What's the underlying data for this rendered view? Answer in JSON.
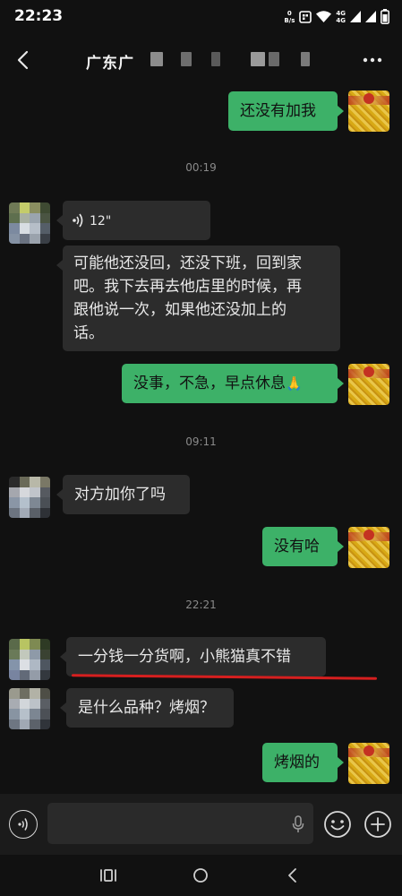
{
  "status_bar": {
    "time": "22:23",
    "speed_top": "0",
    "speed_bottom": "B/s",
    "net_top": "4G",
    "net_bottom": "4G",
    "icons": [
      "nfc-icon",
      "wifi-icon",
      "signal-icon",
      "signal-icon",
      "battery-icon"
    ]
  },
  "header": {
    "title": "广东广",
    "back_icon": "chevron-left-icon",
    "more_icon": "more-dots-icon"
  },
  "messages": [
    {
      "type": "text",
      "side": "out",
      "text": "还没有加我"
    },
    {
      "type": "time",
      "text": "00:19"
    },
    {
      "type": "voice",
      "side": "in",
      "duration": "12\""
    },
    {
      "type": "text",
      "side": "in",
      "lines": [
        "可能他还没回，还没下班，回到家",
        "吧。我下去再去他店里的时候，再",
        "跟他说一次，如果他还没加上的",
        "话。"
      ]
    },
    {
      "type": "text",
      "side": "out",
      "text": "没事，不急，早点休息",
      "emoji": "🙏"
    },
    {
      "type": "time",
      "text": "09:11"
    },
    {
      "type": "text",
      "side": "in",
      "text": "对方加你了吗"
    },
    {
      "type": "text",
      "side": "out",
      "text": "没有哈"
    },
    {
      "type": "time",
      "text": "22:21"
    },
    {
      "type": "text",
      "side": "in",
      "text": "一分钱一分货啊，小熊猫真不错"
    },
    {
      "type": "text",
      "side": "in",
      "text": "是什么品种？烤烟？"
    },
    {
      "type": "text",
      "side": "out",
      "text": "烤烟的"
    }
  ],
  "input_bar": {
    "voice_icon": "voice-mode-icon",
    "mic_icon": "microphone-icon",
    "emoji_icon": "emoji-icon",
    "plus_icon": "plus-icon"
  },
  "system_nav": {
    "icons": [
      "recent-apps-icon",
      "home-icon",
      "back-icon"
    ]
  },
  "colors": {
    "background": "#111111",
    "outgoing_bubble": "#3db168",
    "incoming_bubble": "#2c2c2c",
    "annotation": "#d61f1f"
  }
}
